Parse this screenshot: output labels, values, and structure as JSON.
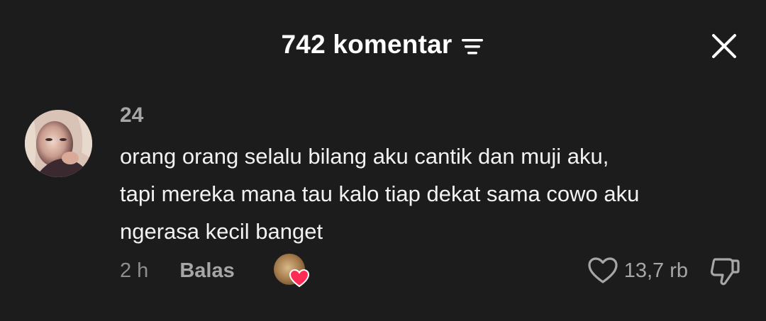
{
  "header": {
    "title": "742 komentar",
    "sort_icon": "sort-lines-icon",
    "close_icon": "close-icon"
  },
  "comment": {
    "username": "24",
    "text": "orang orang selalu bilang aku cantik dan muji aku,\ntapi mereka mana tau kalo tiap dekat sama cowo aku\nngerasa kecil banget",
    "time": "2 h",
    "reply_label": "Balas",
    "like_count": "13,7 rb",
    "like_icon": "heart-outline-icon",
    "dislike_icon": "thumbs-down-icon",
    "creator_liked_icon": "creator-heart-icon"
  },
  "colors": {
    "background": "#1c1c1c",
    "text_primary": "#f2f2f2",
    "text_secondary": "#a6a6a6",
    "heart_badge": "#fe2c55"
  }
}
